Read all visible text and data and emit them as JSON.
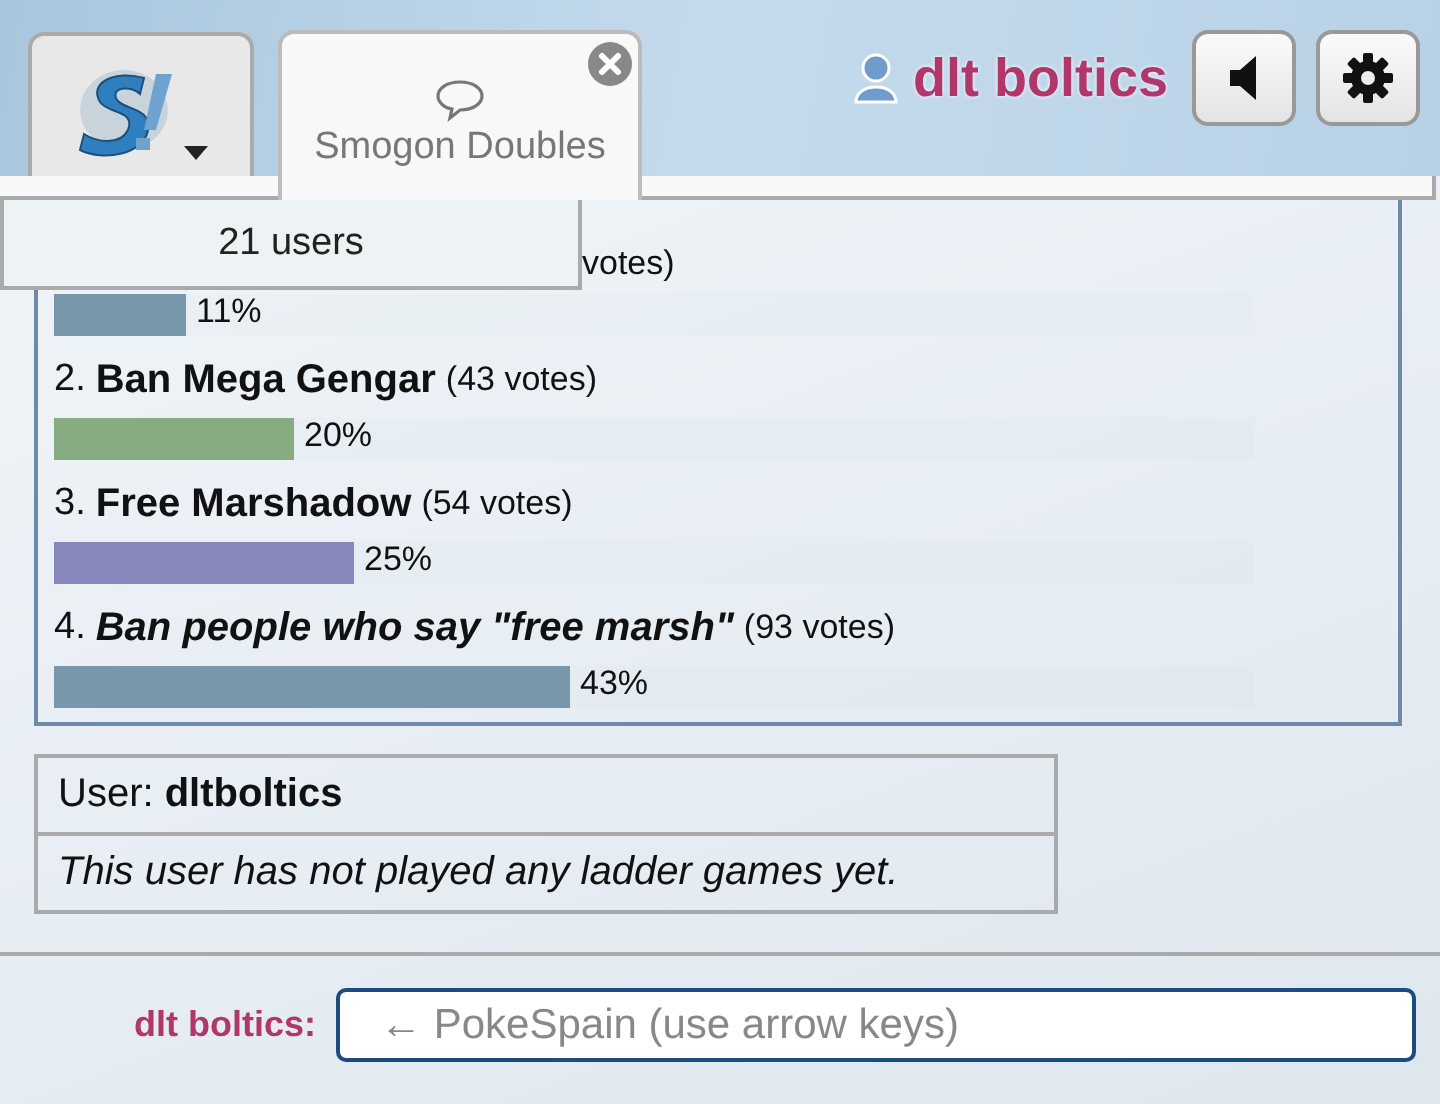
{
  "header": {
    "logo_tab": {
      "selected": false
    },
    "room_tab": {
      "label": "Smogon Doubles",
      "selected": true
    },
    "username": "dlt boltics"
  },
  "userlist": {
    "label": "21 users"
  },
  "poll": {
    "options": [
      {
        "votes": "votes)",
        "percent": "11%",
        "level": 0.11,
        "color": "#7897aa"
      },
      {
        "number": "2.",
        "title": "Ban Mega Gengar",
        "votes": "(43 votes)",
        "percent": "20%",
        "level": 0.2,
        "color": "#88ab82"
      },
      {
        "number": "3.",
        "title": "Free Marshadow",
        "votes": "(54 votes)",
        "percent": "25%",
        "level": 0.25,
        "color": "#8787bb"
      },
      {
        "number": "4.",
        "title": "Ban people who say \"free marsh\"",
        "italic": true,
        "votes": "(93 votes)",
        "percent": "43%",
        "level": 0.43,
        "color": "#7897aa"
      }
    ]
  },
  "ladder": {
    "user": "User: **dltboltics**",
    "message": "This user has not played any ladder games yet."
  },
  "chatbox": {
    "name": "dlt boltics:",
    "placeholder": "← PokeSpain (use arrow keys)"
  }
}
